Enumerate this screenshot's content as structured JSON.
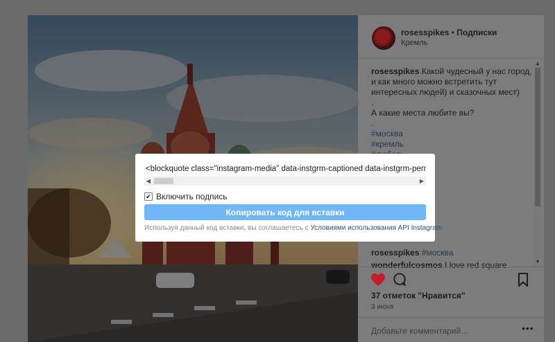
{
  "post": {
    "username": "rosesspikes",
    "separator": "•",
    "follow_label": "Подписки",
    "location": "Кремль"
  },
  "caption": {
    "username": "rosesspikes",
    "line1": "Какой чудесный у нас город, и как много можно встретить тут интересных людей) и сказочных мест)",
    "dot1": ".",
    "line2": "А какие места любите вы?",
    "dot2": ".",
    "tags": [
      "#москва",
      "#кремль",
      "#любовь"
    ]
  },
  "comments": [
    {
      "username": "rosesspikes",
      "text": "#москва"
    },
    {
      "username": "wonderfulcosmos",
      "text": "I love red square"
    }
  ],
  "likes_label": "37 отметок \"Нравится\"",
  "date_label": "3 июня",
  "add_comment_placeholder": "Добавьте комментарий...",
  "more_label": "•••",
  "embed": {
    "code": "<blockquote class=\"instagram-media\" data-instgrm-captioned data-instgrm-permalink",
    "include_caption_label": "Включить подпись",
    "include_caption_checked": true,
    "copy_button_label": "Копировать код для вставки",
    "legal_prefix": "Используя данный код вставки, вы соглашаетесь с",
    "legal_link": "Условиями использования API Instagram",
    "legal_suffix": "."
  },
  "icons": {
    "heart": "heart-icon",
    "comment": "comment-icon",
    "bookmark": "bookmark-icon"
  },
  "colors": {
    "like_red": "#c61d2b",
    "button_blue": "#70b7f5",
    "link": "#2f4f75"
  }
}
